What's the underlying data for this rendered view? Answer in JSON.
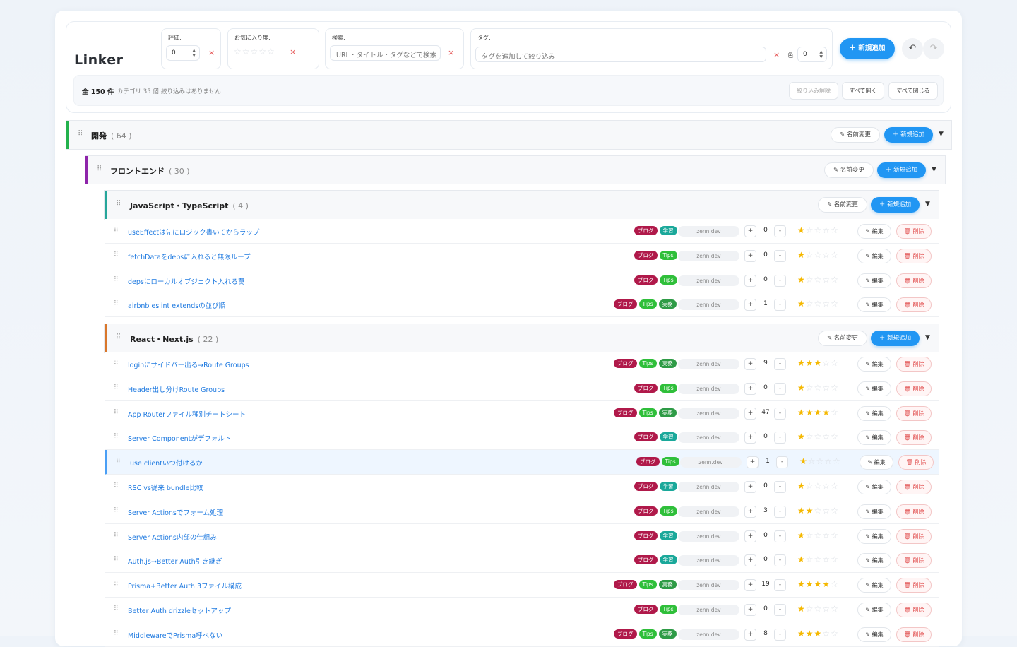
{
  "app": {
    "title": "Linker"
  },
  "filters": {
    "rating": {
      "label": "評価:",
      "value": "0",
      "clear": "×"
    },
    "favorite": {
      "label": "お気に入り度:",
      "stars": "☆☆☆☆☆",
      "clear": "×"
    },
    "search": {
      "label": "検索:",
      "placeholder": "URL・タイトル・タグなどで検索",
      "clear": "×"
    },
    "tags": {
      "label": "タグ:",
      "placeholder": "タグを追加して絞り込み",
      "clear": "×",
      "color_label": "色",
      "color_value": "0"
    }
  },
  "toolbar": {
    "new_label": "＋ 新規追加",
    "undo_icon": "↶",
    "redo_icon": "↷"
  },
  "summary": {
    "total": "全 150 件",
    "categories": "カテゴリ 35 個",
    "filter_status": "絞り込みはありません",
    "clear_filter": "絞り込み解除",
    "expand_all": "すべて開く",
    "collapse_all": "すべて閉じる"
  },
  "section_actions": {
    "rename": "名前変更",
    "new": "＋ 新規追加",
    "caret": "▼",
    "drag": "⠿"
  },
  "row_actions": {
    "edit": "編集",
    "delete": "削除",
    "plus": "+",
    "minus": "-",
    "drag": "⠿"
  },
  "colors": {
    "accent": "#2196f3",
    "section_dev": "#22b14c",
    "section_frontend": "#8e24aa",
    "section_js": "#26a69a",
    "section_react": "#d9772b",
    "tag_blog": "#b0194a",
    "tag_learning": "#1aa89a",
    "tag_tips": "#2fbf3a",
    "tag_practice": "#2e9b46",
    "star": "#f5b800"
  },
  "sections": [
    {
      "name": "開発",
      "count": "( 64 )"
    },
    {
      "name": "フロントエンド",
      "count": "( 30 )"
    },
    {
      "name": "JavaScript・TypeScript",
      "count": "( 4 )"
    },
    {
      "name": "React・Next.js",
      "count": "( 22 )"
    }
  ],
  "js_links": [
    {
      "title": "useEffectは先にロジック書いてからラップ",
      "tags": [
        "ブログ",
        "学習"
      ],
      "domain": "zenn.dev",
      "count": "0",
      "rating": 1
    },
    {
      "title": "fetchDataをdepsに入れると無限ループ",
      "tags": [
        "ブログ",
        "Tips"
      ],
      "domain": "zenn.dev",
      "count": "0",
      "rating": 1
    },
    {
      "title": "depsにローカルオブジェクト入れる罠",
      "tags": [
        "ブログ",
        "Tips"
      ],
      "domain": "zenn.dev",
      "count": "0",
      "rating": 1
    },
    {
      "title": "airbnb eslint extendsの並び順",
      "tags": [
        "ブログ",
        "Tips",
        "実務"
      ],
      "domain": "zenn.dev",
      "count": "1",
      "rating": 1
    }
  ],
  "react_links": [
    {
      "title": "loginにサイドバー出る→Route Groups",
      "tags": [
        "ブログ",
        "Tips",
        "実務"
      ],
      "domain": "zenn.dev",
      "count": "9",
      "rating": 3
    },
    {
      "title": "Header出し分けRoute Groups",
      "tags": [
        "ブログ",
        "Tips"
      ],
      "domain": "zenn.dev",
      "count": "0",
      "rating": 1
    },
    {
      "title": "App Routerファイル種別チートシート",
      "tags": [
        "ブログ",
        "Tips",
        "実務"
      ],
      "domain": "zenn.dev",
      "count": "47",
      "rating": 4
    },
    {
      "title": "Server Componentがデフォルト",
      "tags": [
        "ブログ",
        "学習"
      ],
      "domain": "zenn.dev",
      "count": "0",
      "rating": 1
    },
    {
      "title": "use clientいつ付けるか",
      "tags": [
        "ブログ",
        "Tips"
      ],
      "domain": "zenn.dev",
      "count": "1",
      "rating": 1,
      "selected": true
    },
    {
      "title": "RSC vs従来 bundle比較",
      "tags": [
        "ブログ",
        "学習"
      ],
      "domain": "zenn.dev",
      "count": "0",
      "rating": 1
    },
    {
      "title": "Server Actionsでフォーム処理",
      "tags": [
        "ブログ",
        "Tips"
      ],
      "domain": "zenn.dev",
      "count": "3",
      "rating": 2
    },
    {
      "title": "Server Actions内部の仕組み",
      "tags": [
        "ブログ",
        "学習"
      ],
      "domain": "zenn.dev",
      "count": "0",
      "rating": 1
    },
    {
      "title": "Auth.js→Better Auth引き継ぎ",
      "tags": [
        "ブログ",
        "学習"
      ],
      "domain": "zenn.dev",
      "count": "0",
      "rating": 1
    },
    {
      "title": "Prisma+Better Auth 3ファイル構成",
      "tags": [
        "ブログ",
        "Tips",
        "実務"
      ],
      "domain": "zenn.dev",
      "count": "19",
      "rating": 4
    },
    {
      "title": "Better Auth drizzleセットアップ",
      "tags": [
        "ブログ",
        "Tips"
      ],
      "domain": "zenn.dev",
      "count": "0",
      "rating": 1
    },
    {
      "title": "MiddlewareでPrisma呼べない",
      "tags": [
        "ブログ",
        "Tips",
        "実務"
      ],
      "domain": "zenn.dev",
      "count": "8",
      "rating": 3
    }
  ]
}
